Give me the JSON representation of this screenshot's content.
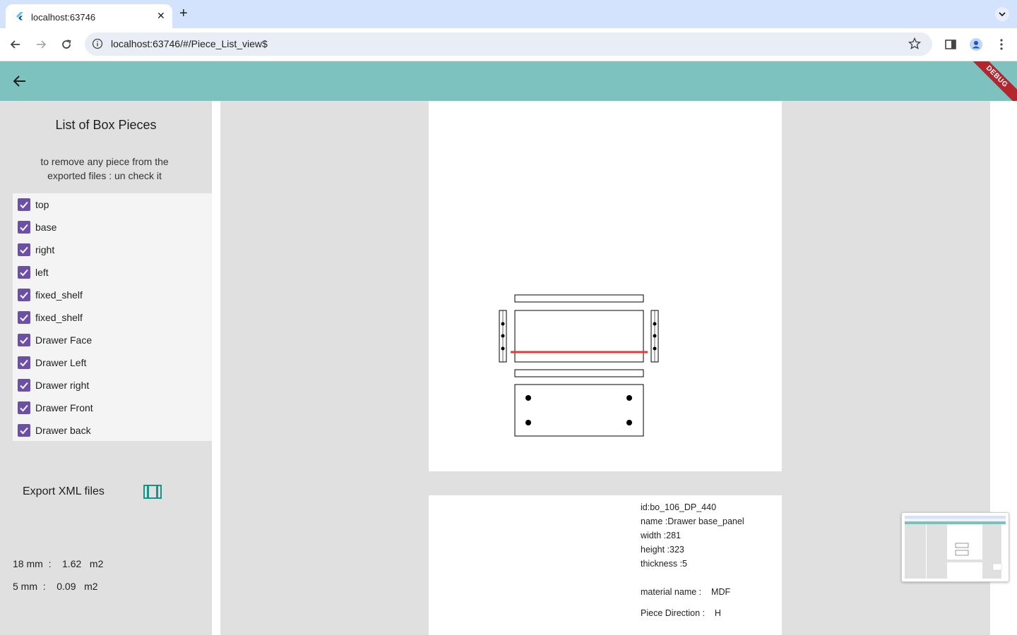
{
  "browser": {
    "tab_title": "localhost:63746",
    "url": "localhost:63746/#/Piece_List_view$"
  },
  "sidebar": {
    "title": "List of Box Pieces",
    "subtitle": "to remove any piece from the exported files : un check it",
    "pieces": [
      {
        "label": "top",
        "checked": true
      },
      {
        "label": "base",
        "checked": true
      },
      {
        "label": "right",
        "checked": true
      },
      {
        "label": "left",
        "checked": true
      },
      {
        "label": "fixed_shelf",
        "checked": true
      },
      {
        "label": "fixed_shelf",
        "checked": true
      },
      {
        "label": "Drawer Face",
        "checked": true
      },
      {
        "label": "Drawer Left",
        "checked": true
      },
      {
        "label": "Drawer right",
        "checked": true
      },
      {
        "label": "Drawer Front",
        "checked": true
      },
      {
        "label": "Drawer back",
        "checked": true
      }
    ],
    "export_label": "Export XML files",
    "areas": [
      {
        "text": "18 mm  :    1.62   m2"
      },
      {
        "text": "5 mm  :    0.09   m2"
      }
    ]
  },
  "piece_info": {
    "id": "id:bo_106_DP_440",
    "name": "name :Drawer base_panel",
    "width": "width :281",
    "height": "height :323",
    "thickness": "thickness :5",
    "material": "material name :    MDF",
    "direction": "Piece Direction :    H"
  },
  "app": {
    "debug_label": "DEBUG"
  },
  "colors": {
    "appbar": "#7ec2c0",
    "checkbox": "#6b4fa8",
    "accent_icon": "#149687",
    "cut_line": "#e53935"
  }
}
